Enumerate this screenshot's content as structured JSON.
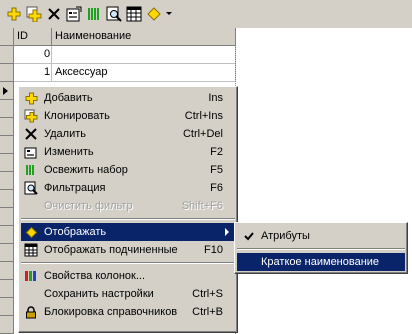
{
  "toolbar": {
    "buttons": [
      {
        "icon": "add-icon"
      },
      {
        "icon": "clone-icon"
      },
      {
        "icon": "delete-icon"
      },
      {
        "icon": "edit-icon"
      },
      {
        "icon": "refresh-icon"
      },
      {
        "icon": "filter-icon"
      },
      {
        "icon": "show-children-icon"
      },
      {
        "icon": "display-icon"
      }
    ]
  },
  "grid": {
    "columns": [
      "ID",
      "Наименование"
    ],
    "rows": [
      {
        "id": "0",
        "name": ""
      },
      {
        "id": "1",
        "name": "Аксессуар"
      }
    ]
  },
  "context_menu": {
    "items": [
      {
        "label": "Добавить",
        "shortcut": "Ins",
        "icon": "add-icon"
      },
      {
        "label": "Клонировать",
        "shortcut": "Ctrl+Ins",
        "icon": "clone-icon"
      },
      {
        "label": "Удалить",
        "shortcut": "Ctrl+Del",
        "icon": "delete-icon"
      },
      {
        "label": "Изменить",
        "shortcut": "F2",
        "icon": "edit-icon"
      },
      {
        "label": "Освежить набор",
        "shortcut": "F5",
        "icon": "refresh-icon"
      },
      {
        "label": "Фильтрация",
        "shortcut": "F6",
        "icon": "filter-icon"
      },
      {
        "label": "Очистить фильтр",
        "shortcut": "Shift+F6",
        "disabled": true
      },
      {
        "label": "Отображать",
        "shortcut": "",
        "icon": "display-icon",
        "selected": true,
        "submenu": true
      },
      {
        "label": "Отображать подчиненные",
        "shortcut": "F10",
        "icon": "show-children-icon"
      },
      {
        "label": "Свойства колонок...",
        "shortcut": "",
        "icon": "column-props-icon"
      },
      {
        "label": "Сохранить настройки",
        "shortcut": "Ctrl+S"
      },
      {
        "label": "Блокировка справочников",
        "shortcut": "Ctrl+B",
        "icon": "lock-icon"
      }
    ]
  },
  "submenu": {
    "items": [
      {
        "label": "Атрибуты",
        "checked": true
      },
      {
        "label": "Краткое наименование",
        "selected": true
      }
    ]
  },
  "colors": {
    "face": "#d4d0c8",
    "highlight": "#0a246a",
    "add_yellow": "#ffd800",
    "refresh_green": "#20a020"
  }
}
